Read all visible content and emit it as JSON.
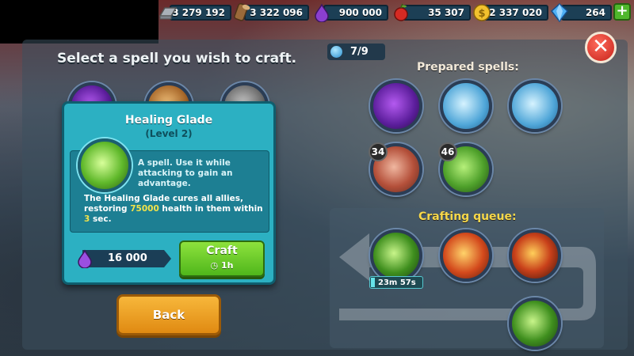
{
  "resources": [
    {
      "name": "iron",
      "icon": "iron-ingot-icon",
      "value": "3 279 192"
    },
    {
      "name": "wood",
      "icon": "wood-log-icon",
      "value": "3 322 096"
    },
    {
      "name": "mana",
      "icon": "mana-drop-icon",
      "value": "900 000"
    },
    {
      "name": "food",
      "icon": "apple-icon",
      "value": "35 307"
    },
    {
      "name": "gold",
      "icon": "gold-coin-icon",
      "value": "2 337 020"
    },
    {
      "name": "gems",
      "icon": "diamond-icon",
      "value": "264"
    }
  ],
  "plus_label": "+",
  "title": "Select a spell you wish to craft.",
  "close_label": "✕",
  "slots": "7/9",
  "prepared_title": "Prepared spells:",
  "prepared_spells": [
    {
      "icon": "purple-meteor-spell-icon"
    },
    {
      "icon": "ice-spell-icon"
    },
    {
      "icon": "ice-spell-icon"
    },
    {
      "icon": "meat-spell-icon",
      "count": "34"
    },
    {
      "icon": "green-meteor-spell-icon",
      "count": "46"
    }
  ],
  "queue_title": "Crafting queue:",
  "queue": [
    {
      "icon": "healing-glade-spell-icon",
      "timer": "23m 57s"
    },
    {
      "icon": "fire-warrior-spell-icon"
    },
    {
      "icon": "fire-hands-spell-icon"
    },
    {
      "icon": "healing-glade-spell-icon"
    }
  ],
  "popup": {
    "title": "Healing Glade",
    "level": "(Level 2)",
    "short_desc": "A spell. Use it while attacking to gain an advantage.",
    "desc_before": "The Healing Glade cures all allies, restoring ",
    "desc_amount": "75000",
    "desc_middle": " health in them within ",
    "desc_time": "3",
    "desc_after": " sec.",
    "cost": "16 000",
    "craft_label": "Craft",
    "craft_time": "1h"
  },
  "back_label": "Back",
  "colors": {
    "popup_bg": "#2cb0c2",
    "craft_green": "#4fb61b",
    "back_orange": "#e08a12",
    "close_red": "#c6221a",
    "highlight_yellow": "#f2e34a"
  }
}
